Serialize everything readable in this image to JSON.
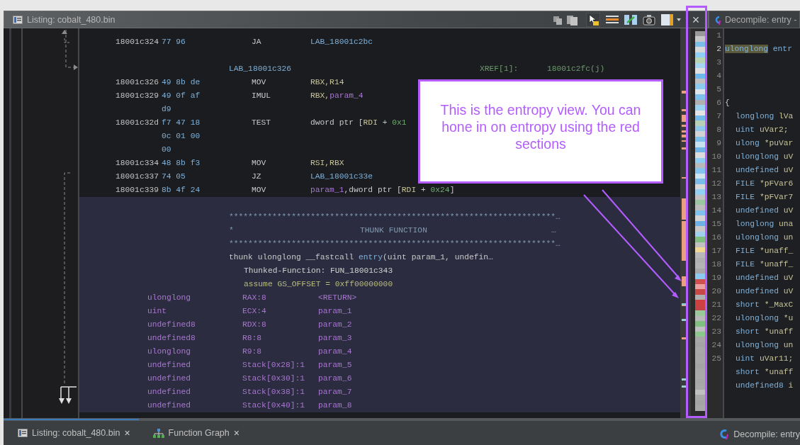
{
  "listing_window": {
    "title": "Listing:  cobalt_480.bin",
    "close": "×"
  },
  "listing": [
    {
      "kind": "instruction",
      "selected": false,
      "address": "18001c324",
      "bytes": [
        "77 96"
      ],
      "mnemonic": "JA",
      "operands": [
        {
          "text": "LAB_18001c2bc",
          "kind": "label"
        }
      ]
    },
    {
      "kind": "blank",
      "selected": false
    },
    {
      "kind": "label",
      "selected": false,
      "label": "LAB_18001c326",
      "xref_label": "XREF[1]:",
      "xref_value": "18001c2fc(j)"
    },
    {
      "kind": "instruction",
      "selected": false,
      "address": "18001c326",
      "bytes": [
        "49 8b de"
      ],
      "mnemonic": "MOV",
      "operands": [
        {
          "text": "RBX,R14",
          "kind": "register"
        }
      ]
    },
    {
      "kind": "instruction",
      "selected": false,
      "address": "18001c329",
      "bytes": [
        "49 0f af",
        "d9"
      ],
      "mnemonic": "IMUL",
      "operands": [
        {
          "text": "RBX,",
          "kind": "register"
        },
        {
          "text": "param_4",
          "kind": "param"
        }
      ]
    },
    {
      "kind": "instruction",
      "selected": false,
      "address": "18001c32d",
      "bytes": [
        "f7 47 18",
        "0c 01 00",
        "00"
      ],
      "mnemonic": "TEST",
      "operands": [
        {
          "text": "dword ptr [",
          "kind": "plain"
        },
        {
          "text": "RDI",
          "kind": "register"
        },
        {
          "text": " + ",
          "kind": "plain"
        },
        {
          "text": "0x1",
          "kind": "number"
        }
      ]
    },
    {
      "kind": "instruction",
      "selected": false,
      "address": "18001c334",
      "bytes": [
        "48 8b f3"
      ],
      "mnemonic": "MOV",
      "operands": [
        {
          "text": "RSI,RBX",
          "kind": "register"
        }
      ]
    },
    {
      "kind": "instruction",
      "selected": false,
      "address": "18001c337",
      "bytes": [
        "74 05"
      ],
      "mnemonic": "JZ",
      "operands": [
        {
          "text": "LAB_18001c33e",
          "kind": "label"
        }
      ]
    },
    {
      "kind": "instruction",
      "selected": false,
      "address": "18001c339",
      "bytes": [
        "8b 4f 24"
      ],
      "mnemonic": "MOV",
      "operands": [
        {
          "text": "param_1",
          "kind": "param"
        },
        {
          "text": ",dword ptr [",
          "kind": "plain"
        },
        {
          "text": "RDI",
          "kind": "register"
        },
        {
          "text": " + ",
          "kind": "plain"
        },
        {
          "text": "0x24",
          "kind": "number"
        },
        {
          "text": "]",
          "kind": "plain"
        }
      ]
    },
    {
      "kind": "blank",
      "selected": true
    },
    {
      "kind": "banner",
      "selected": true,
      "text": "********************************************************************…"
    },
    {
      "kind": "banner_title",
      "selected": true,
      "star": "*",
      "title": "THUNK FUNCTION",
      "ellipsis": "…"
    },
    {
      "kind": "banner",
      "selected": true,
      "text": "********************************************************************…"
    },
    {
      "kind": "signature",
      "selected": true,
      "tokens": [
        {
          "text": "thunk ulonglong __fastcall ",
          "kind": "plain"
        },
        {
          "text": "entry",
          "kind": "label"
        },
        {
          "text": "(uint param_1, undefin…",
          "kind": "plain"
        }
      ]
    },
    {
      "kind": "thunked",
      "selected": true,
      "text": "Thunked-Function: FUN_18001c343"
    },
    {
      "kind": "assume",
      "selected": true,
      "text": "assume GS_OFFSET = 0xff00000000"
    },
    {
      "kind": "param",
      "selected": true,
      "type": "ulonglong",
      "storage": "RAX:8",
      "name": "<RETURN>"
    },
    {
      "kind": "param",
      "selected": true,
      "type": "uint",
      "storage": "ECX:4",
      "name": "param_1"
    },
    {
      "kind": "param",
      "selected": true,
      "type": "undefined8",
      "storage": "RDX:8",
      "name": "param_2"
    },
    {
      "kind": "param",
      "selected": true,
      "type": "undefined8",
      "storage": "R8:8",
      "name": "param_3"
    },
    {
      "kind": "param",
      "selected": true,
      "type": "ulonglong",
      "storage": "R9:8",
      "name": "param_4"
    },
    {
      "kind": "param",
      "selected": true,
      "type": "undefined",
      "storage": "Stack[0x28]:1",
      "name": "param_5"
    },
    {
      "kind": "param",
      "selected": true,
      "type": "undefined",
      "storage": "Stack[0x30]:1",
      "name": "param_6"
    },
    {
      "kind": "param",
      "selected": true,
      "type": "undefined",
      "storage": "Stack[0x38]:1",
      "name": "param_7"
    },
    {
      "kind": "param",
      "selected": true,
      "type": "undefined",
      "storage": "Stack[0x40]:1",
      "name": "param_8"
    }
  ],
  "decompile_window": {
    "title": "Decompile: entry -"
  },
  "decompile": [
    {
      "number": "1",
      "kind": "empty",
      "highlighted": false
    },
    {
      "number": "2",
      "kind": "signature",
      "highlighted": true,
      "type": "ulonglong",
      "rest": " entr"
    },
    {
      "number": "3",
      "kind": "empty",
      "highlighted": false
    },
    {
      "number": "4",
      "kind": "empty",
      "highlighted": false
    },
    {
      "number": "5",
      "kind": "empty",
      "highlighted": false
    },
    {
      "number": "6",
      "kind": "brace",
      "highlighted": false,
      "rest": "{"
    },
    {
      "number": "7",
      "kind": "declaration",
      "highlighted": false,
      "type": "longlong",
      "rest": " lVa"
    },
    {
      "number": "8",
      "kind": "declaration",
      "highlighted": false,
      "type": "uint",
      "rest": " uVar2;"
    },
    {
      "number": "9",
      "kind": "declaration",
      "highlighted": false,
      "type": "ulong",
      "rest": " *puVar"
    },
    {
      "number": "10",
      "kind": "declaration",
      "highlighted": false,
      "type": "ulonglong",
      "rest": " uV"
    },
    {
      "number": "11",
      "kind": "declaration",
      "highlighted": false,
      "type": "undefined",
      "rest": " uV"
    },
    {
      "number": "12",
      "kind": "declaration",
      "highlighted": false,
      "type": "FILE",
      "rest": " *pFVar6"
    },
    {
      "number": "13",
      "kind": "declaration",
      "highlighted": false,
      "type": "FILE",
      "rest": " *pFVar7"
    },
    {
      "number": "14",
      "kind": "declaration",
      "highlighted": false,
      "type": "undefined",
      "rest": " uV"
    },
    {
      "number": "15",
      "kind": "declaration",
      "highlighted": false,
      "type": "longlong",
      "rest": " una"
    },
    {
      "number": "16",
      "kind": "declaration",
      "highlighted": false,
      "type": "ulonglong",
      "rest": " un"
    },
    {
      "number": "17",
      "kind": "declaration",
      "highlighted": false,
      "type": "FILE",
      "rest": " *unaff_"
    },
    {
      "number": "18",
      "kind": "declaration",
      "highlighted": false,
      "type": "FILE",
      "rest": " *unaff_"
    },
    {
      "number": "19",
      "kind": "declaration",
      "highlighted": false,
      "type": "undefined",
      "rest": " uV"
    },
    {
      "number": "20",
      "kind": "declaration",
      "highlighted": false,
      "type": "undefined",
      "rest": " uV"
    },
    {
      "number": "21",
      "kind": "declaration",
      "highlighted": false,
      "type": "short",
      "rest": " *_MaxC"
    },
    {
      "number": "22",
      "kind": "declaration",
      "highlighted": false,
      "type": "ulonglong",
      "rest": " *u"
    },
    {
      "number": "23",
      "kind": "declaration",
      "highlighted": false,
      "type": "short",
      "rest": " *unaff"
    },
    {
      "number": "24",
      "kind": "declaration",
      "highlighted": false,
      "type": "ulonglong",
      "rest": " un"
    },
    {
      "number": "25",
      "kind": "declaration",
      "highlighted": false,
      "type": "uint",
      "rest": " uVar11;"
    },
    {
      "kind": "declaration",
      "highlighted": false,
      "type": "short",
      "rest": " *unaff"
    },
    {
      "kind": "declaration",
      "highlighted": false,
      "type": "undefined8",
      "rest": " i"
    }
  ],
  "callout": {
    "text": "This is the entropy view. You can hone in on entropy using the red sections"
  },
  "bottom_tabs": [
    {
      "label": "Listing:  cobalt_480.bin",
      "close": "×",
      "kind": "listing",
      "selected": true
    },
    {
      "label": "Function Graph",
      "close": "×",
      "kind": "graph",
      "selected": false
    }
  ],
  "right_tab": {
    "label": "Decompile: entry"
  }
}
